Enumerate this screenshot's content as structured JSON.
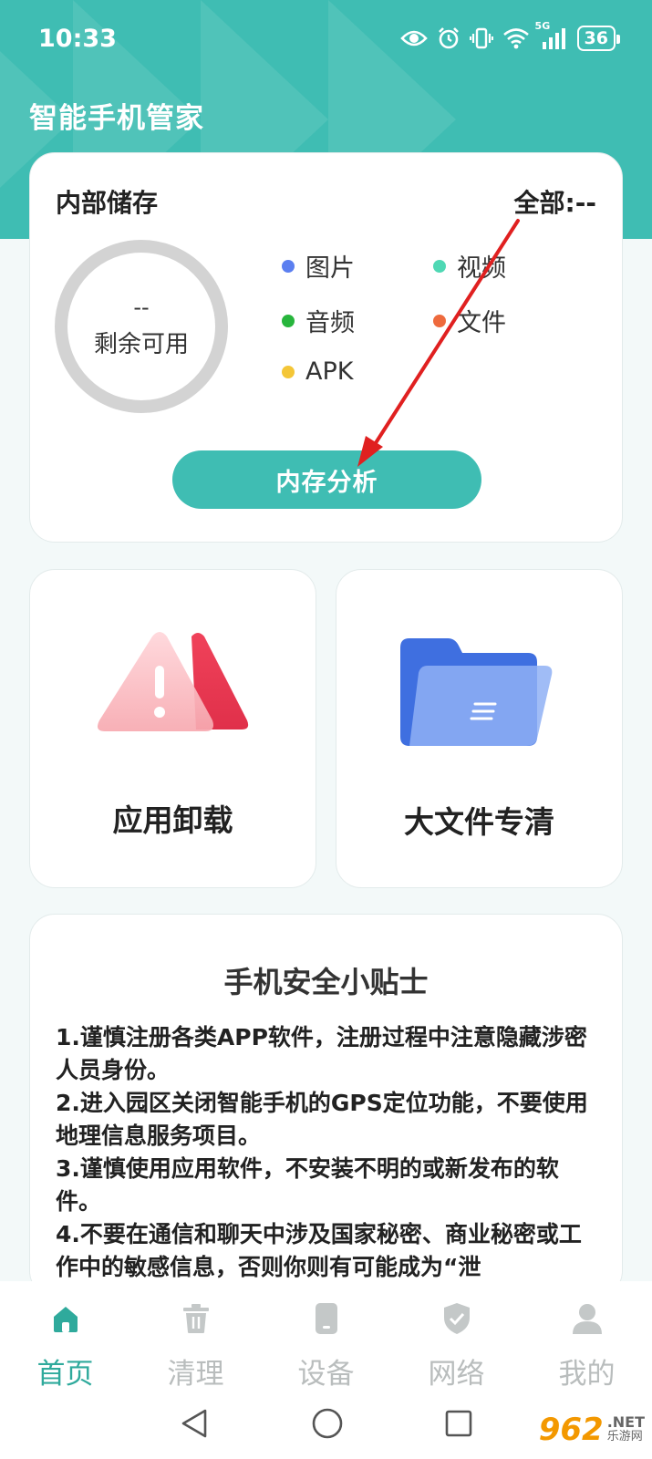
{
  "status_bar": {
    "time": "10:33",
    "battery": "36",
    "signal_label": "5G"
  },
  "app": {
    "title": "智能手机管家"
  },
  "storage": {
    "title": "内部储存",
    "total": "全部:--",
    "ring_value": "--",
    "ring_label": "剩余可用",
    "legend": [
      {
        "label": "图片",
        "color": "#5b7ff0"
      },
      {
        "label": "视频",
        "color": "#4fd8b4"
      },
      {
        "label": "音频",
        "color": "#27b53c"
      },
      {
        "label": "文件",
        "color": "#ee6a3d"
      },
      {
        "label": "APK",
        "color": "#f4c637"
      }
    ],
    "analyze_button": "内存分析"
  },
  "tiles": {
    "uninstall": {
      "label": "应用卸载",
      "icon": "warning-triangle-icon"
    },
    "bigfile": {
      "label": "大文件专清",
      "icon": "folder-icon"
    }
  },
  "tips": {
    "title": "手机安全小贴士",
    "items": [
      " 1.谨慎注册各类APP软件，注册过程中注意隐藏涉密人员身份。",
      " 2.进入园区关闭智能手机的GPS定位功能，不要使用地理信息服务项目。",
      " 3.谨慎使用应用软件，不安装不明的或新发布的软件。",
      " 4.不要在通信和聊天中涉及国家秘密、商业秘密或工作中的敏感信息，否则你则有可能成为“泄"
    ]
  },
  "bottom_nav": [
    {
      "label": "首页",
      "icon": "home-icon",
      "active": true
    },
    {
      "label": "清理",
      "icon": "trash-icon",
      "active": false
    },
    {
      "label": "设备",
      "icon": "phone-icon",
      "active": false
    },
    {
      "label": "网络",
      "icon": "shield-icon",
      "active": false
    },
    {
      "label": "我的",
      "icon": "user-icon",
      "active": false
    }
  ],
  "watermark": {
    "number": "962",
    "net": ".NET",
    "cn": "乐游网"
  },
  "colors": {
    "accent": "#3fbdb3",
    "nav_active": "#2faa9c",
    "nav_inactive": "#b9bdbd",
    "arrow": "#e02020"
  }
}
